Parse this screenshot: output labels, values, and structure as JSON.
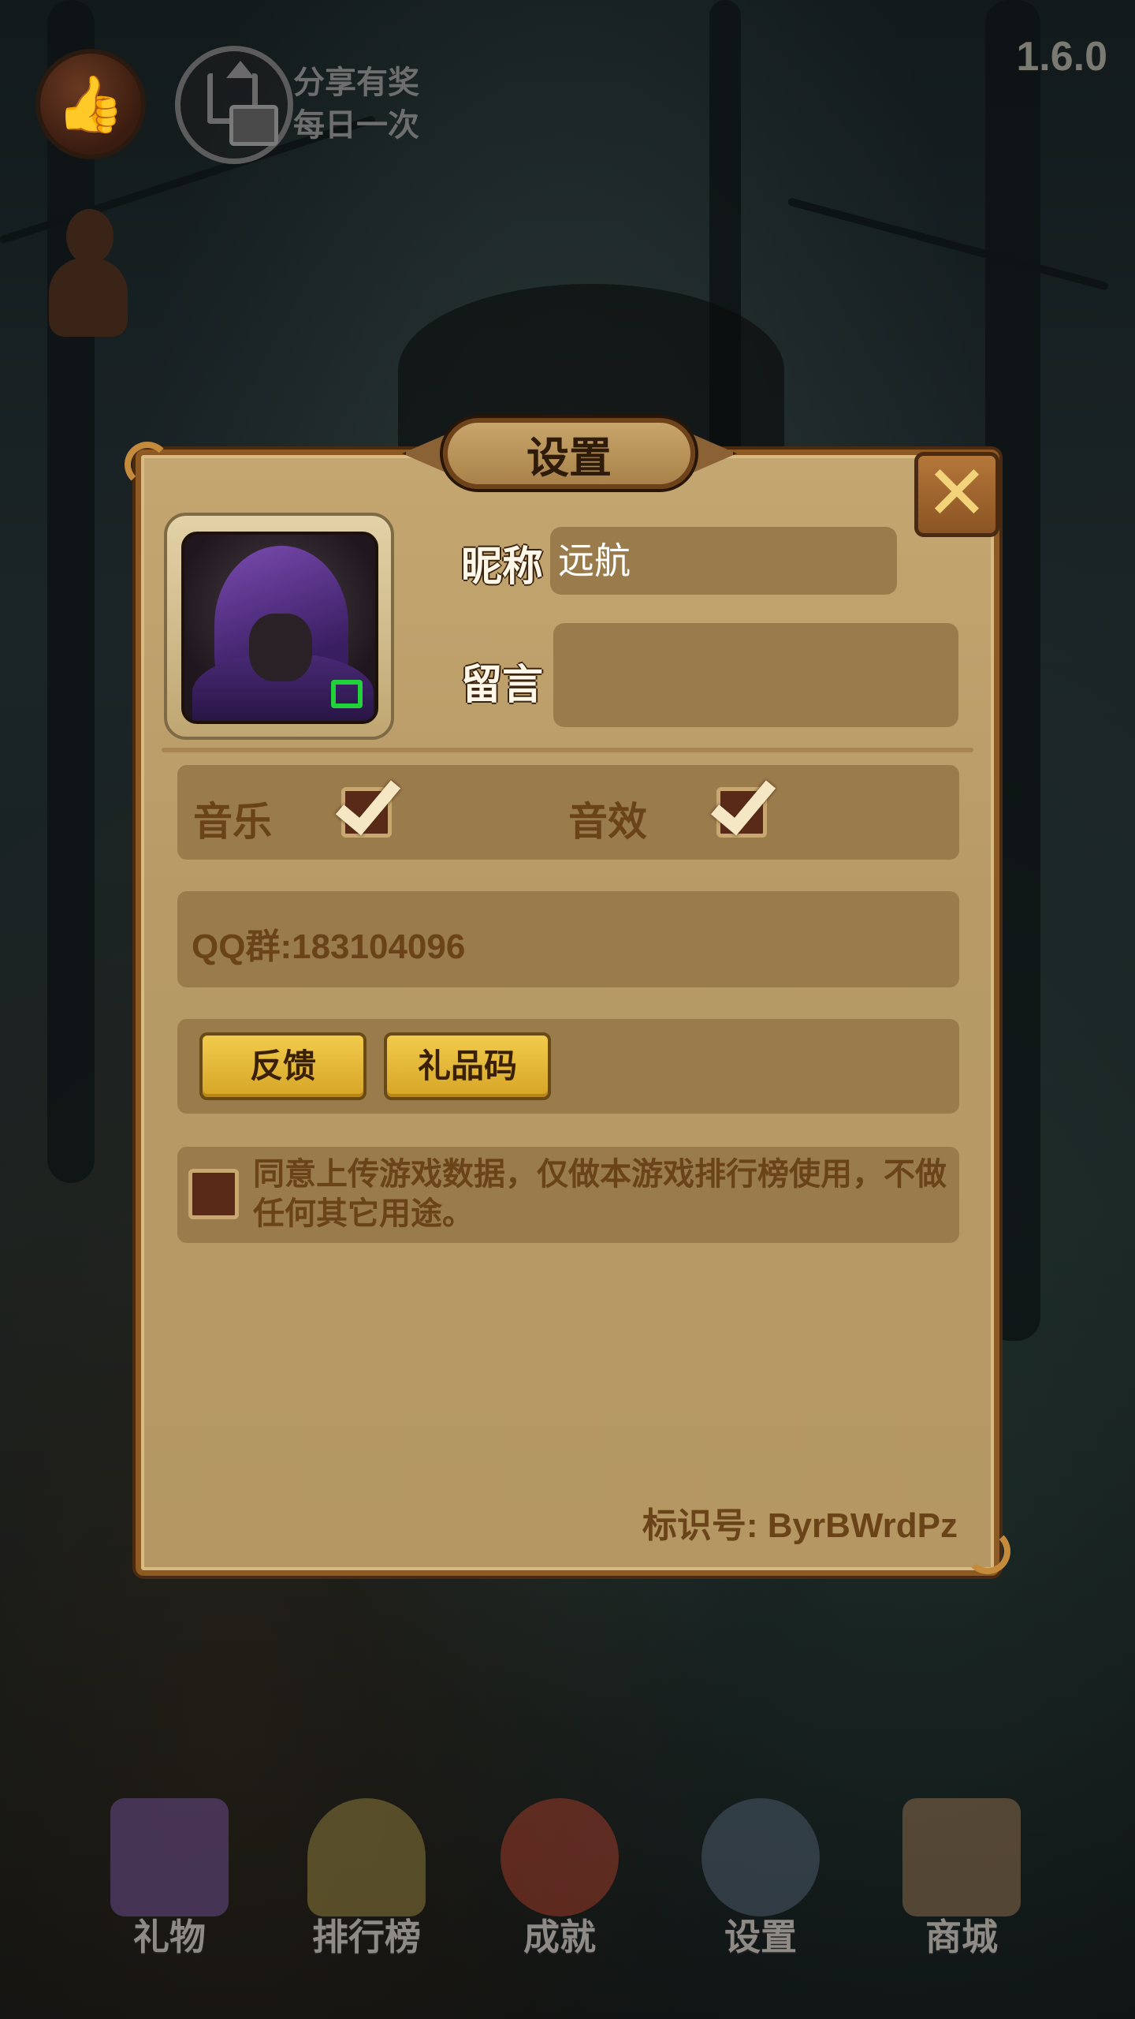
{
  "top": {
    "share_line1": "分享有奖",
    "share_line2": "每日一次",
    "version": "1.6.0"
  },
  "dialog": {
    "title": "设置",
    "nickname_label": "昵称",
    "nickname_value": "远航",
    "message_label": "留言",
    "message_value": "",
    "music_label": "音乐",
    "music_checked": true,
    "sfx_label": "音效",
    "sfx_checked": true,
    "qq_group": "QQ群:183104096",
    "feedback_button": "反馈",
    "giftcode_button": "礼品码",
    "consent_text": "同意上传游戏数据，仅做本游戏排行榜使用，不做任何其它用途。",
    "consent_checked": false,
    "identifier": "标识号: ByrBWrdPz"
  },
  "nav": {
    "items": [
      {
        "label": "礼物",
        "icon": "gift-icon",
        "color": "#6a4a8a"
      },
      {
        "label": "排行榜",
        "icon": "trophy-icon",
        "color": "#8a7a3a"
      },
      {
        "label": "成就",
        "icon": "medal-icon",
        "color": "#9a3a2a"
      },
      {
        "label": "设置",
        "icon": "gear-icon",
        "color": "#4a5a6a"
      },
      {
        "label": "商城",
        "icon": "cart-icon",
        "color": "#8a6a4a"
      }
    ]
  },
  "colors": {
    "panel": "#b79a66",
    "field": "#9a7b4b",
    "button_yellow": "#e8bb3a",
    "text_brown": "#6a4318"
  }
}
